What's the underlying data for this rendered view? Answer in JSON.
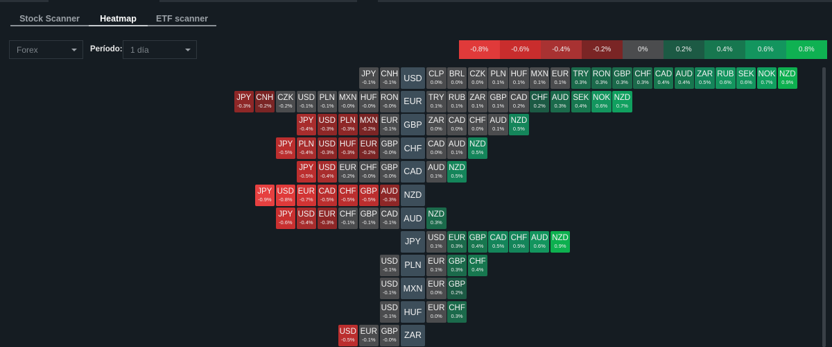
{
  "tabs": [
    {
      "label": "Stock Scanner",
      "active": false
    },
    {
      "label": "Heatmap",
      "active": true
    },
    {
      "label": "ETF scanner",
      "active": false
    }
  ],
  "filters": {
    "market": "Forex",
    "period_label": "Período:",
    "period": "1 día"
  },
  "legend": [
    {
      "label": "-0.8%",
      "color": "#e03a3a"
    },
    {
      "label": "-0.6%",
      "color": "#c92d2d"
    },
    {
      "label": "-0.4%",
      "color": "#a83232"
    },
    {
      "label": "-0.2%",
      "color": "#7a2525"
    },
    {
      "label": "0%",
      "color": "#4b4c4e"
    },
    {
      "label": "0.2%",
      "color": "#1c5a44"
    },
    {
      "label": "0.4%",
      "color": "#17774f"
    },
    {
      "label": "0.6%",
      "color": "#13955e"
    },
    {
      "label": "0.8%",
      "color": "#0fb152"
    }
  ],
  "rows": [
    {
      "base": "USD",
      "left": [
        [
          "JPY",
          "-0.1%"
        ],
        [
          "CNH",
          "-0.1%"
        ]
      ],
      "right": [
        [
          "CLP",
          "0.0%"
        ],
        [
          "BRL",
          "0.0%"
        ],
        [
          "CZK",
          "0.0%"
        ],
        [
          "PLN",
          "0.1%"
        ],
        [
          "HUF",
          "0.1%"
        ],
        [
          "MXN",
          "0.1%"
        ],
        [
          "EUR",
          "0.1%"
        ],
        [
          "TRY",
          "0.3%"
        ],
        [
          "RON",
          "0.3%"
        ],
        [
          "GBP",
          "0.3%"
        ],
        [
          "CHF",
          "0.3%"
        ],
        [
          "CAD",
          "0.4%"
        ],
        [
          "AUD",
          "0.4%"
        ],
        [
          "ZAR",
          "0.5%"
        ],
        [
          "RUB",
          "0.6%"
        ],
        [
          "SEK",
          "0.6%"
        ],
        [
          "NOK",
          "0.7%"
        ],
        [
          "NZD",
          "0.9%"
        ]
      ]
    },
    {
      "base": "EUR",
      "left": [
        [
          "JPY",
          "-0.3%"
        ],
        [
          "CNH",
          "-0.2%"
        ],
        [
          "CZK",
          "-0.2%",
          "#4b4c4e"
        ],
        [
          "USD",
          "-0.1%"
        ],
        [
          "PLN",
          "-0.1%"
        ],
        [
          "MXN",
          "-0.0%"
        ],
        [
          "HUF",
          "-0.0%"
        ],
        [
          "RON",
          "-0.0%"
        ]
      ],
      "right": [
        [
          "TRY",
          "0.1%"
        ],
        [
          "RUB",
          "0.1%"
        ],
        [
          "ZAR",
          "0.1%"
        ],
        [
          "GBP",
          "0.1%"
        ],
        [
          "CAD",
          "0.2%",
          "#4b4c4e"
        ],
        [
          "CHF",
          "0.2%"
        ],
        [
          "AUD",
          "0.3%"
        ],
        [
          "SEK",
          "0.4%"
        ],
        [
          "NOK",
          "0.6%"
        ],
        [
          "NZD",
          "0.7%"
        ]
      ]
    },
    {
      "base": "GBP",
      "left": [
        [
          "JPY",
          "-0.4%"
        ],
        [
          "USD",
          "-0.3%"
        ],
        [
          "PLN",
          "-0.3%"
        ],
        [
          "MXN",
          "-0.2%"
        ],
        [
          "EUR",
          "-0.1%"
        ]
      ],
      "right": [
        [
          "ZAR",
          "0.0%"
        ],
        [
          "CAD",
          "0.0%"
        ],
        [
          "CHF",
          "0.0%"
        ],
        [
          "AUD",
          "0.1%"
        ],
        [
          "NZD",
          "0.5%"
        ]
      ]
    },
    {
      "base": "CHF",
      "left": [
        [
          "JPY",
          "-0.5%"
        ],
        [
          "PLN",
          "-0.4%"
        ],
        [
          "USD",
          "-0.3%"
        ],
        [
          "HUF",
          "-0.3%"
        ],
        [
          "EUR",
          "-0.2%"
        ],
        [
          "GBP",
          "-0.0%"
        ]
      ],
      "right": [
        [
          "CAD",
          "0.0%"
        ],
        [
          "AUD",
          "0.1%"
        ],
        [
          "NZD",
          "0.5%"
        ]
      ]
    },
    {
      "base": "CAD",
      "left": [
        [
          "JPY",
          "-0.5%"
        ],
        [
          "USD",
          "-0.4%"
        ],
        [
          "EUR",
          "-0.2%",
          "#4b4c4e"
        ],
        [
          "CHF",
          "-0.0%"
        ],
        [
          "GBP",
          "-0.0%"
        ]
      ],
      "right": [
        [
          "AUD",
          "0.1%"
        ],
        [
          "NZD",
          "0.5%"
        ]
      ]
    },
    {
      "base": "NZD",
      "left": [
        [
          "JPY",
          "-0.9%"
        ],
        [
          "USD",
          "-0.8%"
        ],
        [
          "EUR",
          "-0.7%"
        ],
        [
          "CAD",
          "-0.5%"
        ],
        [
          "CHF",
          "-0.5%"
        ],
        [
          "GBP",
          "-0.5%"
        ],
        [
          "AUD",
          "-0.3%"
        ]
      ],
      "right": []
    },
    {
      "base": "AUD",
      "left": [
        [
          "JPY",
          "-0.6%"
        ],
        [
          "USD",
          "-0.4%"
        ],
        [
          "EUR",
          "-0.3%"
        ],
        [
          "CHF",
          "-0.1%"
        ],
        [
          "GBP",
          "-0.1%"
        ],
        [
          "CAD",
          "-0.1%"
        ]
      ],
      "right": [
        [
          "NZD",
          "0.3%"
        ]
      ]
    },
    {
      "base": "JPY",
      "left": [],
      "right": [
        [
          "USD",
          "0.1%"
        ],
        [
          "EUR",
          "0.3%"
        ],
        [
          "GBP",
          "0.4%"
        ],
        [
          "CAD",
          "0.5%"
        ],
        [
          "CHF",
          "0.5%"
        ],
        [
          "AUD",
          "0.6%"
        ],
        [
          "NZD",
          "0.9%"
        ]
      ]
    },
    {
      "base": "PLN",
      "left": [
        [
          "USD",
          "-0.1%"
        ]
      ],
      "right": [
        [
          "EUR",
          "0.1%"
        ],
        [
          "GBP",
          "0.3%"
        ],
        [
          "CHF",
          "0.4%"
        ]
      ]
    },
    {
      "base": "MXN",
      "left": [
        [
          "USD",
          "-0.1%"
        ]
      ],
      "right": [
        [
          "EUR",
          "0.0%"
        ],
        [
          "GBP",
          "0.2%"
        ]
      ]
    },
    {
      "base": "HUF",
      "left": [
        [
          "USD",
          "-0.1%"
        ]
      ],
      "right": [
        [
          "EUR",
          "0.0%"
        ],
        [
          "CHF",
          "0.3%"
        ]
      ]
    },
    {
      "base": "ZAR",
      "left": [
        [
          "USD",
          "-0.5%"
        ],
        [
          "EUR",
          "-0.1%"
        ],
        [
          "GBP",
          "-0.0%"
        ]
      ],
      "right": []
    }
  ]
}
